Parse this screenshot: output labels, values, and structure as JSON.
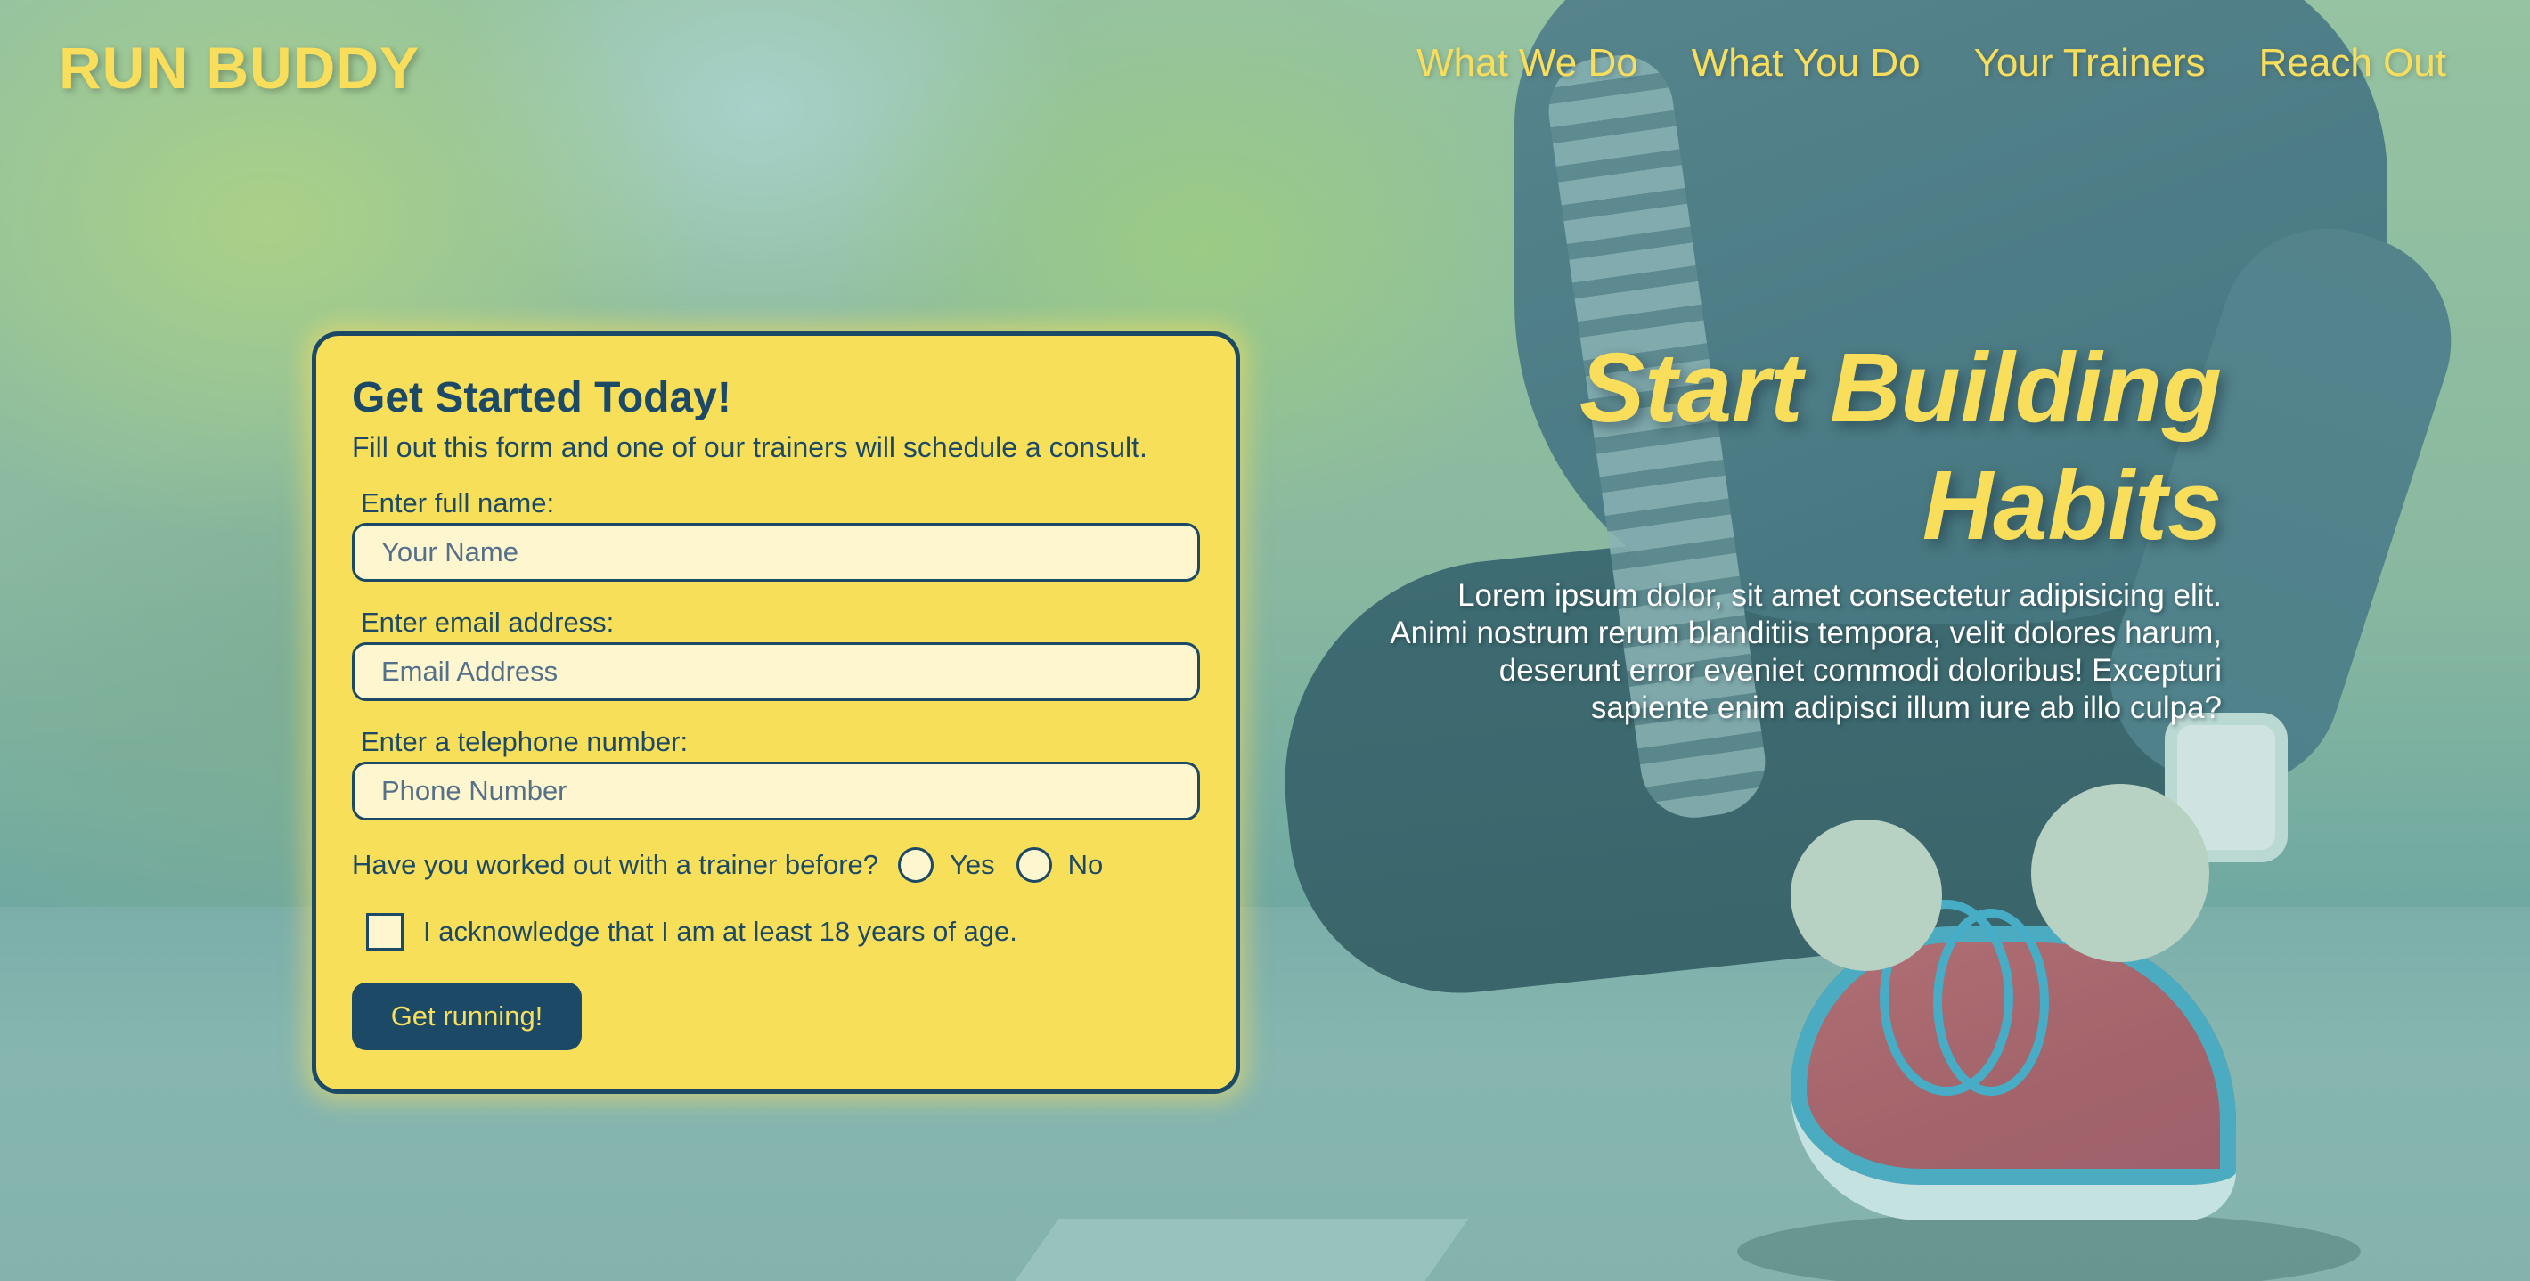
{
  "header": {
    "logo": "RUN BUDDY",
    "nav": [
      {
        "label": "What We Do"
      },
      {
        "label": "What You Do"
      },
      {
        "label": "Your Trainers"
      },
      {
        "label": "Reach Out"
      }
    ]
  },
  "form": {
    "title": "Get Started Today!",
    "subtitle": "Fill out this form and one of our trainers will schedule a consult.",
    "fields": [
      {
        "label": "Enter full name:",
        "placeholder": "Your Name"
      },
      {
        "label": "Enter email address:",
        "placeholder": "Email Address"
      },
      {
        "label": "Enter a telephone number:",
        "placeholder": "Phone Number"
      }
    ],
    "trainer_question": "Have you worked out with a trainer before?",
    "radio_options": [
      "Yes",
      "No"
    ],
    "age_acknowledgement": "I acknowledge that I am at least 18 years of age.",
    "submit_label": "Get running!"
  },
  "hero": {
    "heading": "Start Building Habits",
    "body": "Lorem ipsum dolor, sit amet consectetur adipisicing elit. Animi nostrum rerum blanditiis tempora, velit dolores harum, deserunt error eveniet commodi doloribus! Excepturi sapiente enim adipisci illum iure ab illo culpa?"
  },
  "colors": {
    "accent_yellow": "#f8df5a",
    "primary_navy": "#1c4a66"
  }
}
